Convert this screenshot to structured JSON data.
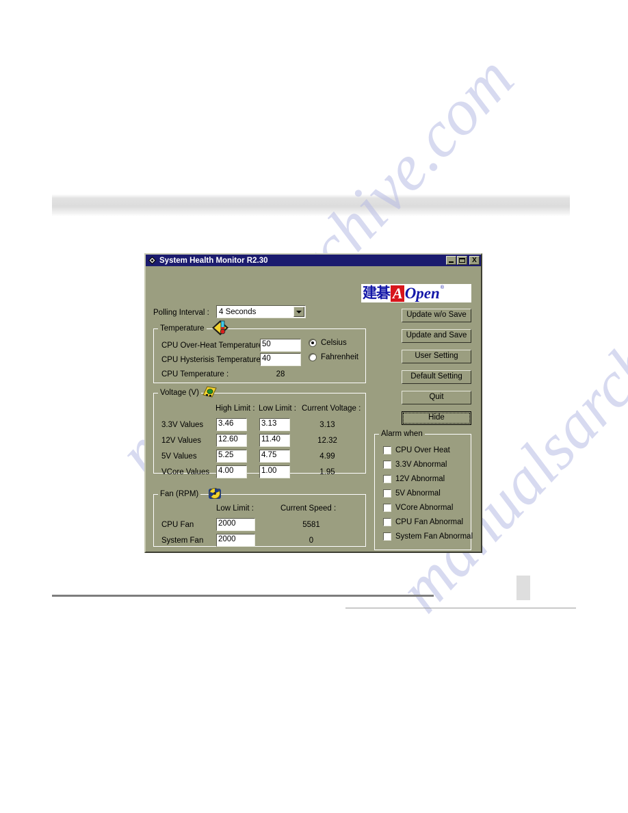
{
  "window": {
    "title": "System Health Monitor R2.30",
    "title_icon": "diamond-app-icon",
    "minimize_label": "_",
    "maximize_label": "□",
    "close_label": "X"
  },
  "logo": {
    "chinese": "建碁",
    "a": "A",
    "open": "Open",
    "registered": "®"
  },
  "polling": {
    "label": "Polling Interval :",
    "value": "4 Seconds",
    "arrow_icon": "chevron-down-icon"
  },
  "temperature": {
    "legend": "Temperature",
    "icon": "thermometer-icon",
    "rows": [
      {
        "label": "CPU Over-Heat Temperature",
        "value": "50",
        "editable": true
      },
      {
        "label": "CPU Hysterisis Temperature :",
        "value": "40",
        "editable": true
      },
      {
        "label": "CPU Temperature :",
        "value": "28",
        "editable": false
      }
    ],
    "units": [
      {
        "label": "Celsius",
        "selected": true
      },
      {
        "label": "Fahrenheit",
        "selected": false
      }
    ]
  },
  "voltage": {
    "legend": "Voltage (V)",
    "icon": "multimeter-icon",
    "headers": {
      "high": "High Limit :",
      "low": "Low Limit :",
      "current": "Current Voltage :"
    },
    "rows": [
      {
        "label": "3.3V Values",
        "high": "3.46",
        "low": "3.13",
        "current": "3.13"
      },
      {
        "label": "12V Values",
        "high": "12.60",
        "low": "11.40",
        "current": "12.32"
      },
      {
        "label": "5V Values",
        "high": "5.25",
        "low": "4.75",
        "current": "4.99"
      },
      {
        "label": "VCore Values",
        "high": "4.00",
        "low": "1.00",
        "current": "1.95"
      }
    ]
  },
  "fan": {
    "legend": "Fan (RPM)",
    "icon": "fan-icon",
    "headers": {
      "low": "Low Limit :",
      "current": "Current Speed :"
    },
    "rows": [
      {
        "label": "CPU Fan",
        "low": "2000",
        "current": "5581"
      },
      {
        "label": "System Fan",
        "low": "2000",
        "current": "0"
      }
    ]
  },
  "buttons": [
    {
      "label": "Update w/o Save",
      "focused": false
    },
    {
      "label": "Update and Save",
      "focused": false
    },
    {
      "label": "User Setting",
      "focused": false
    },
    {
      "label": "Default Setting",
      "focused": false
    },
    {
      "label": "Quit",
      "focused": false
    },
    {
      "label": "Hide",
      "focused": true
    }
  ],
  "alarm": {
    "legend": "Alarm when",
    "items": [
      {
        "label": "CPU Over Heat",
        "checked": false
      },
      {
        "label": "3.3V Abnormal",
        "checked": false
      },
      {
        "label": "12V Abnormal",
        "checked": false
      },
      {
        "label": "5V Abnormal",
        "checked": false
      },
      {
        "label": "VCore Abnormal",
        "checked": false
      },
      {
        "label": "CPU Fan Abnormal",
        "checked": false
      },
      {
        "label": "System Fan Abnormal",
        "checked": false
      }
    ]
  },
  "page": {
    "watermark": "manualsarchive.com"
  },
  "colors": {
    "dialog_face": "#9b9e80",
    "titlebar": "#1b1b6e",
    "logo_blue": "#1418a8",
    "logo_red": "#d8161c",
    "field_white": "#ffffff"
  }
}
